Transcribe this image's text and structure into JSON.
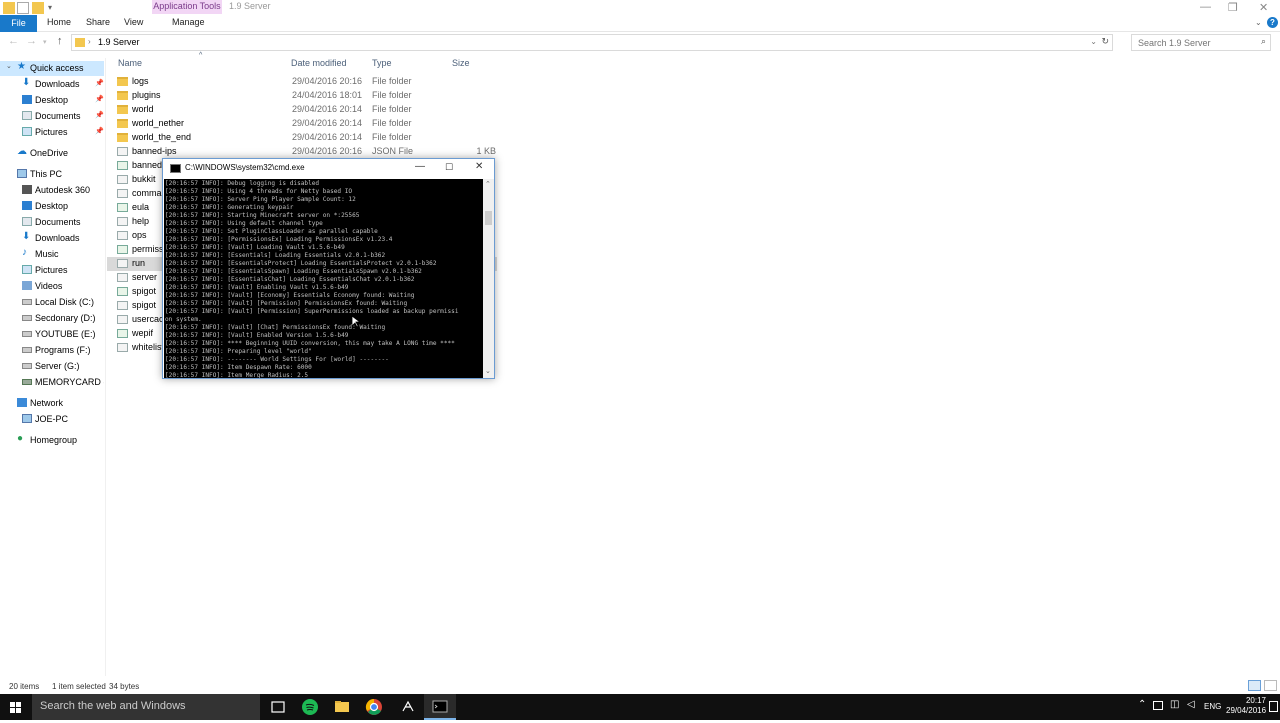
{
  "window": {
    "context_tab": "Application Tools",
    "title": "1.9 Server"
  },
  "ribbon": {
    "file": "File",
    "tabs": [
      "Home",
      "Share",
      "View",
      "Manage"
    ]
  },
  "address": {
    "path": "1.9 Server",
    "search_placeholder": "Search 1.9 Server"
  },
  "sidebar": {
    "items": [
      {
        "label": "Quick access",
        "icon": "star-icon"
      },
      {
        "label": "Downloads",
        "icon": "download-icon"
      },
      {
        "label": "Desktop",
        "icon": "desktop-icon"
      },
      {
        "label": "Documents",
        "icon": "documents-icon"
      },
      {
        "label": "Pictures",
        "icon": "pictures-icon"
      },
      {
        "label": "OneDrive",
        "icon": "cloud-icon"
      },
      {
        "label": "This PC",
        "icon": "computer-icon"
      },
      {
        "label": "Autodesk 360",
        "icon": "autodesk-icon"
      },
      {
        "label": "Desktop",
        "icon": "desktop-icon"
      },
      {
        "label": "Documents",
        "icon": "documents-icon"
      },
      {
        "label": "Downloads",
        "icon": "download-icon"
      },
      {
        "label": "Music",
        "icon": "music-icon"
      },
      {
        "label": "Pictures",
        "icon": "pictures-icon"
      },
      {
        "label": "Videos",
        "icon": "videos-icon"
      },
      {
        "label": "Local Disk (C:)",
        "icon": "drive-icon"
      },
      {
        "label": "Secdonary (D:)",
        "icon": "drive-icon"
      },
      {
        "label": "YOUTUBE (E:)",
        "icon": "drive-icon"
      },
      {
        "label": "Programs (F:)",
        "icon": "drive-icon"
      },
      {
        "label": "Server (G:)",
        "icon": "drive-icon"
      },
      {
        "label": "MEMORYCARD (\\\\E",
        "icon": "network-drive-icon"
      },
      {
        "label": "Network",
        "icon": "network-icon"
      },
      {
        "label": "JOE-PC",
        "icon": "computer-icon"
      },
      {
        "label": "Homegroup",
        "icon": "homegroup-icon"
      }
    ]
  },
  "columns": {
    "name": "Name",
    "date": "Date modified",
    "type": "Type",
    "size": "Size"
  },
  "files": [
    {
      "name": "logs",
      "date": "29/04/2016 20:16",
      "type": "File folder",
      "size": "",
      "kind": "folder"
    },
    {
      "name": "plugins",
      "date": "24/04/2016 18:01",
      "type": "File folder",
      "size": "",
      "kind": "folder"
    },
    {
      "name": "world",
      "date": "29/04/2016 20:14",
      "type": "File folder",
      "size": "",
      "kind": "folder"
    },
    {
      "name": "world_nether",
      "date": "29/04/2016 20:14",
      "type": "File folder",
      "size": "",
      "kind": "folder"
    },
    {
      "name": "world_the_end",
      "date": "29/04/2016 20:14",
      "type": "File folder",
      "size": "",
      "kind": "folder"
    },
    {
      "name": "banned-ips",
      "date": "29/04/2016 20:16",
      "type": "JSON File",
      "size": "1 KB",
      "kind": "file"
    },
    {
      "name": "banned-",
      "date": "",
      "type": "",
      "size": "",
      "kind": "file"
    },
    {
      "name": "bukkit",
      "date": "",
      "type": "",
      "size": "",
      "kind": "file"
    },
    {
      "name": "commar",
      "date": "",
      "type": "",
      "size": "",
      "kind": "file"
    },
    {
      "name": "eula",
      "date": "",
      "type": "",
      "size": "",
      "kind": "file"
    },
    {
      "name": "help",
      "date": "",
      "type": "",
      "size": "",
      "kind": "file"
    },
    {
      "name": "ops",
      "date": "",
      "type": "",
      "size": "",
      "kind": "file"
    },
    {
      "name": "permissi",
      "date": "",
      "type": "",
      "size": "",
      "kind": "file"
    },
    {
      "name": "run",
      "date": "",
      "type": "",
      "size": "",
      "kind": "file"
    },
    {
      "name": "server",
      "date": "",
      "type": "",
      "size": "",
      "kind": "file"
    },
    {
      "name": "spigot",
      "date": "",
      "type": "",
      "size": "",
      "kind": "file"
    },
    {
      "name": "spigot",
      "date": "",
      "type": "",
      "size": "",
      "kind": "file"
    },
    {
      "name": "usercach",
      "date": "",
      "type": "",
      "size": "",
      "kind": "file"
    },
    {
      "name": "wepif",
      "date": "",
      "type": "",
      "size": "",
      "kind": "file"
    },
    {
      "name": "whitelist",
      "date": "",
      "type": "",
      "size": "",
      "kind": "file"
    }
  ],
  "status": {
    "count": "20 items",
    "selection": "1 item selected",
    "size": "34 bytes"
  },
  "cmd": {
    "title": "C:\\WINDOWS\\system32\\cmd.exe",
    "lines": [
      "[20:16:57 INFO]: Debug logging is disabled",
      "[20:16:57 INFO]: Using 4 threads for Netty based IO",
      "[20:16:57 INFO]: Server Ping Player Sample Count: 12",
      "[20:16:57 INFO]: Generating keypair",
      "[20:16:57 INFO]: Starting Minecraft server on *:25565",
      "[20:16:57 INFO]: Using default channel type",
      "[20:16:57 INFO]: Set PluginClassLoader as parallel capable",
      "[20:16:57 INFO]: [PermissionsEx] Loading PermissionsEx v1.23.4",
      "[20:16:57 INFO]: [Vault] Loading Vault v1.5.6-b49",
      "[20:16:57 INFO]: [Essentials] Loading Essentials v2.0.1-b362",
      "[20:16:57 INFO]: [EssentialsProtect] Loading EssentialsProtect v2.0.1-b362",
      "[20:16:57 INFO]: [EssentialsSpawn] Loading EssentialsSpawn v2.0.1-b362",
      "[20:16:57 INFO]: [EssentialsChat] Loading EssentialsChat v2.0.1-b362",
      "[20:16:57 INFO]: [Vault] Enabling Vault v1.5.6-b49",
      "[20:16:57 INFO]: [Vault] [Economy] Essentials Economy found: Waiting",
      "[20:16:57 INFO]: [Vault] [Permission] PermissionsEx found: Waiting",
      "[20:16:57 INFO]: [Vault] [Permission] SuperPermissions loaded as backup permissi",
      "on system.",
      "[20:16:57 INFO]: [Vault] [Chat] PermissionsEx found: Waiting",
      "[20:16:57 INFO]: [Vault] Enabled Version 1.5.6-b49",
      "[20:16:57 INFO]: **** Beginning UUID conversion, this may take A LONG time ****",
      "[20:16:57 INFO]: Preparing level \"world\"",
      "[20:16:57 INFO]: -------- World Settings For [world] --------",
      "[20:16:57 INFO]: Item Despawn Rate: 6000",
      "[20:16:57 INFO]: Item Merge Radius: 2.5"
    ]
  },
  "taskbar": {
    "search": "Search the web and Windows",
    "lang": "ENG",
    "time": "20:17",
    "date": "29/04/2016"
  },
  "colors": {
    "accent": "#1979ca",
    "folder": "#f3c74f",
    "selection": "#cce8ff"
  }
}
